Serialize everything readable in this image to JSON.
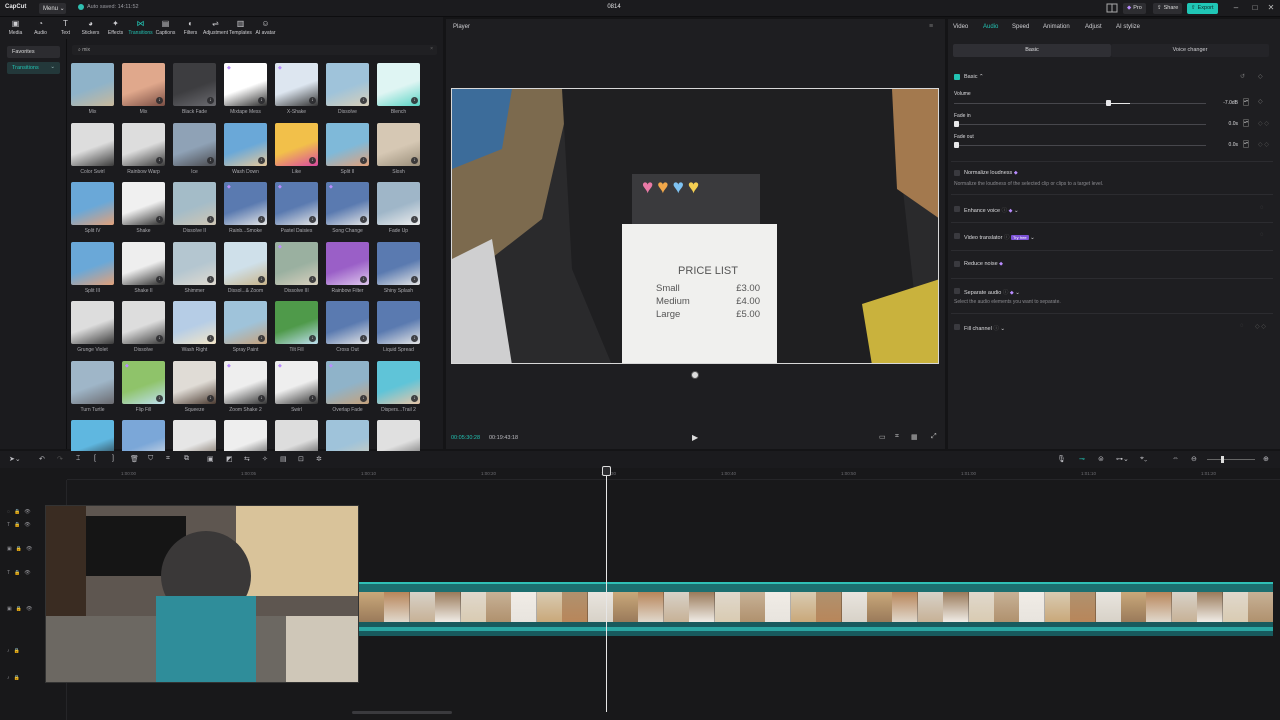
{
  "app": {
    "logo": "CapCut",
    "menu": "Menu",
    "saved": "Auto saved: 14:11:52",
    "project_title": "0814"
  },
  "topbar": {
    "pro": "Pro",
    "share": "Share",
    "export": "Export"
  },
  "media_tools": [
    {
      "label": "Media",
      "icon": "media-icon",
      "glyph": "▣"
    },
    {
      "label": "Audio",
      "icon": "audio-icon",
      "glyph": "◔"
    },
    {
      "label": "Text",
      "icon": "text-icon",
      "glyph": "T"
    },
    {
      "label": "Stickers",
      "icon": "sticker-icon",
      "glyph": "◕"
    },
    {
      "label": "Effects",
      "icon": "effects-icon",
      "glyph": "✦"
    },
    {
      "label": "Transitions",
      "icon": "transitions-icon",
      "glyph": "⋈"
    },
    {
      "label": "Captions",
      "icon": "captions-icon",
      "glyph": "▤"
    },
    {
      "label": "Filters",
      "icon": "filters-icon",
      "glyph": "◐"
    },
    {
      "label": "Adjustment",
      "icon": "adjustment-icon",
      "glyph": "⇌"
    },
    {
      "label": "Templates",
      "icon": "templates-icon",
      "glyph": "▥"
    },
    {
      "label": "AI avatar",
      "icon": "ai-avatar-icon",
      "glyph": "☺"
    }
  ],
  "left_sidebar": {
    "favorites": "Favorites",
    "transitions": "Transitions"
  },
  "search": {
    "value": "mix"
  },
  "transitions": [
    "Mix",
    "Mix",
    "Black Fade",
    "Mixtape Mess",
    "X-Shake",
    "Dissolve",
    "Blench",
    "Color Swirl",
    "Rainbow Warp",
    "Ice",
    "Wash Down",
    "Like",
    "Split II",
    "Slosh",
    "Split IV",
    "Shake",
    "Dissolve II",
    "Rainb...Smoke",
    "Pastel Daisies",
    "Song Change",
    "Fade Up",
    "Split III",
    "Shake II",
    "Shimmer",
    "Dissol...& Zoom",
    "Dissolve III",
    "Rainbow Filter",
    "Shiny Splash",
    "Grunge Violet",
    "Dissolve",
    "Wash Right",
    "Spray Paint",
    "Tilt Fill",
    "Cross Out",
    "Liquid Spread",
    "Turn Turtle",
    "Flip Fill",
    "Squeeze",
    "Zoom Shake 2",
    "Swirl",
    "Overlap Fade",
    "Dispers...Trail 2",
    "",
    "",
    "",
    "",
    "",
    "",
    ""
  ],
  "player": {
    "title": "Player",
    "current_time": "00:05:30:28",
    "total_time": "00:19:43:18"
  },
  "price_list": {
    "heading": "PRICE LIST",
    "rows": [
      [
        "Small",
        "£3.00"
      ],
      [
        "Medium",
        "£4.00"
      ],
      [
        "Large",
        "£5.00"
      ]
    ]
  },
  "right_panel": {
    "tabs": [
      "Video",
      "Audio",
      "Speed",
      "Animation",
      "Adjust",
      "AI stylize"
    ],
    "active_tab": "Audio",
    "subtabs": [
      "Basic",
      "Voice changer"
    ],
    "basic_label": "Basic",
    "volume": {
      "label": "Volume",
      "value": "-7.0dB",
      "level": 0.61
    },
    "fade_in": {
      "label": "Fade in",
      "value": "0.0s"
    },
    "fade_out": {
      "label": "Fade out",
      "value": "0.0s"
    },
    "normalize": {
      "label": "Normalize loudness",
      "desc": "Normalize the loudness of the selected clip or clips to a target level."
    },
    "enhance_voice": "Enhance voice",
    "video_translator": {
      "label": "Video translator",
      "badge": "Try free"
    },
    "reduce_noise": "Reduce noise",
    "separate_audio": {
      "label": "Separate audio",
      "desc": "Select the audio elements you want to separate."
    },
    "fill_channel": "Fill channel"
  },
  "timeline": {
    "ticks": [
      "1:00:00",
      "1:00:05",
      "1:00:10",
      "1:00:20",
      "1:00:30",
      "1:00:40",
      "1:00:50",
      "1:01:00",
      "1:01:10",
      "1:01:20"
    ],
    "zoom_level": 0.3
  },
  "colors": {
    "accent": "#22c3b3",
    "clip": "#1c6f70",
    "export": "#20c6b6"
  }
}
